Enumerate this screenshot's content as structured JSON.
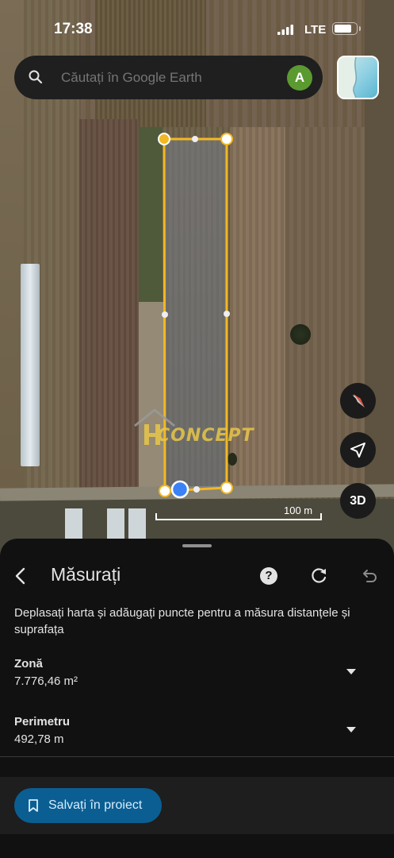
{
  "status_bar": {
    "time": "17:38",
    "network": "LTE"
  },
  "search": {
    "placeholder": "Căutați în Google Earth",
    "avatar_letter": "A"
  },
  "map": {
    "scale_label": "100 m",
    "button_3d": "3D",
    "watermark": "CONCEPT"
  },
  "sheet": {
    "title": "Măsurați",
    "help_symbol": "?",
    "description": "Deplasați harta și adăugați puncte pentru a măsura distanțele și suprafața",
    "area": {
      "label": "Zonă",
      "value": "7.776,46 m²"
    },
    "perimeter": {
      "label": "Perimetru",
      "value": "492,78 m"
    },
    "save_label": "Salvați în proiect"
  },
  "colors": {
    "accent": "#0b5e91",
    "measure_line": "#f2b824",
    "location_dot": "#3b82f6"
  }
}
